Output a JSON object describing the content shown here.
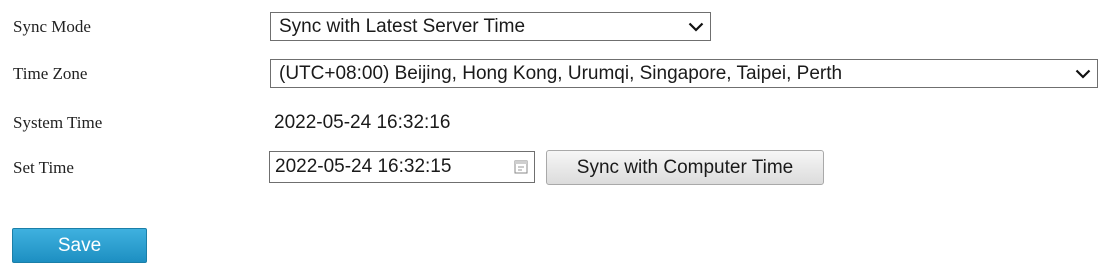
{
  "form": {
    "sync_mode": {
      "label": "Sync Mode",
      "value": "Sync with Latest Server Time",
      "icon": "chevron-down-icon"
    },
    "time_zone": {
      "label": "Time Zone",
      "value": "(UTC+08:00) Beijing, Hong Kong, Urumqi, Singapore, Taipei, Perth",
      "icon": "chevron-down-icon"
    },
    "system_time": {
      "label": "System Time",
      "value": "2022-05-24 16:32:16"
    },
    "set_time": {
      "label": "Set Time",
      "value": "2022-05-24 16:32:15",
      "icon": "calendar-icon",
      "sync_button_label": "Sync with Computer Time"
    }
  },
  "actions": {
    "save_label": "Save"
  },
  "colors": {
    "save_button": "#2a9fd2",
    "border": "#6f6f6f"
  }
}
